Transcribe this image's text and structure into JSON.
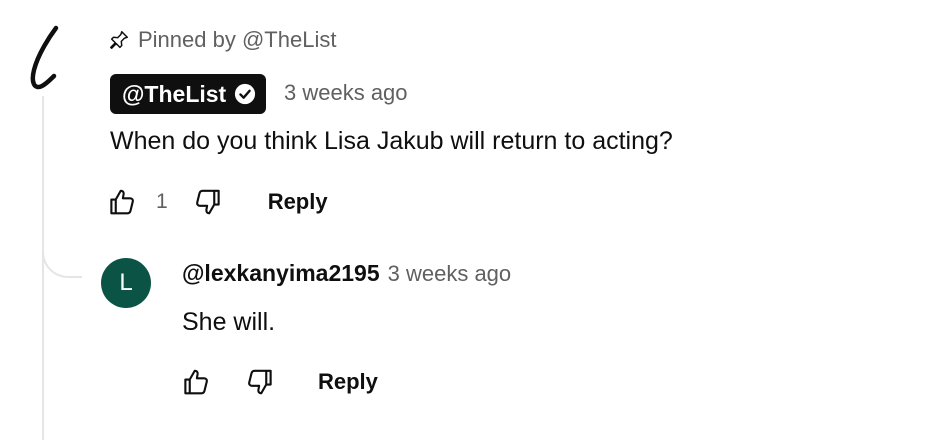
{
  "pinned": {
    "text": "Pinned by @TheList"
  },
  "comment": {
    "author": "@TheList",
    "timestamp": "3 weeks ago",
    "text": "When do you think Lisa Jakub will return to acting?",
    "like_count": "1",
    "reply_label": "Reply",
    "avatar_icon": "handwritten-l-logo-icon"
  },
  "reply": {
    "avatar_letter": "L",
    "avatar_color": "#0b5345",
    "author": "@lexkanyima2195",
    "timestamp": "3 weeks ago",
    "text": "She will.",
    "reply_label": "Reply"
  },
  "colors": {
    "text_primary": "#0f0f0f",
    "text_secondary": "#606060",
    "thread_line": "#e5e5e5"
  }
}
